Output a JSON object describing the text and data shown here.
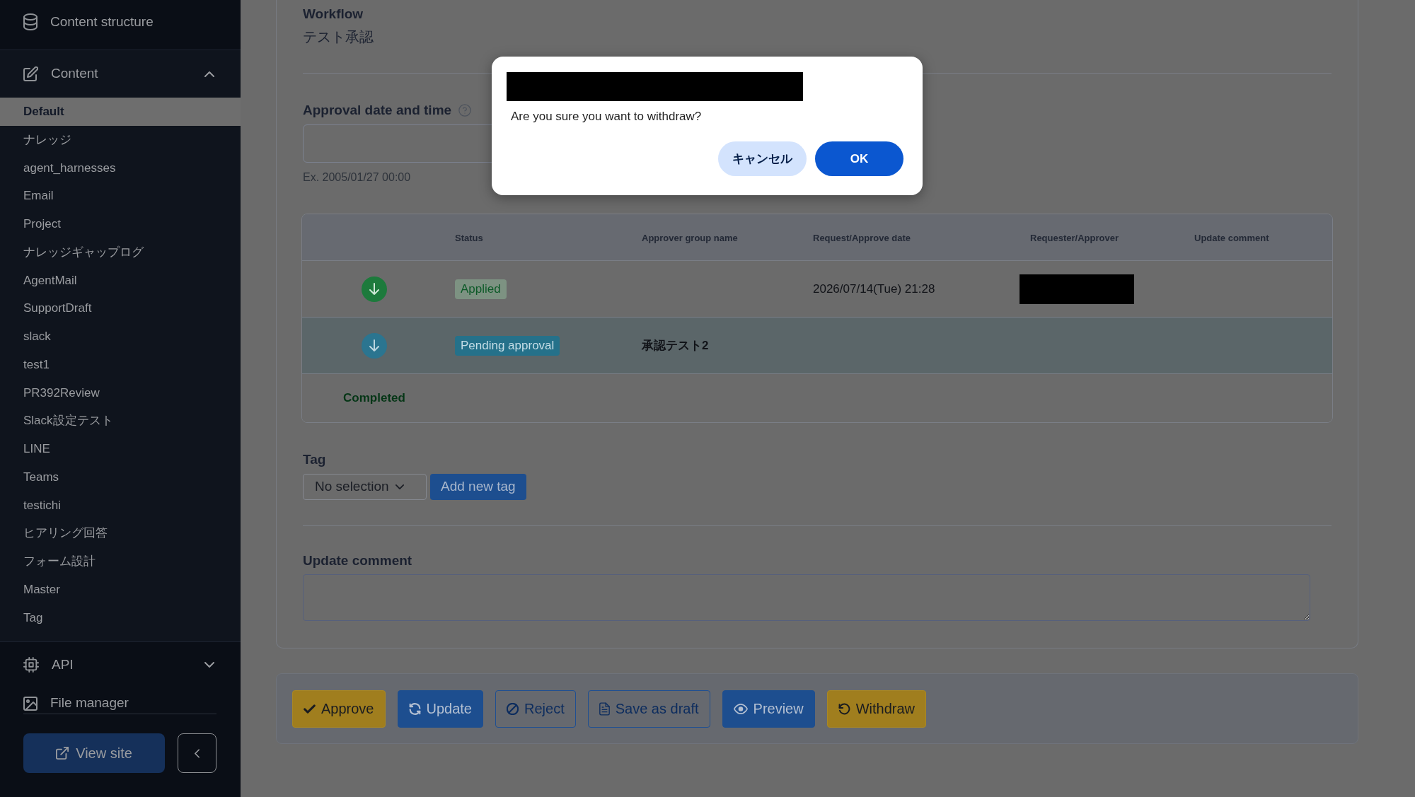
{
  "sidebar": {
    "structure_link": {
      "label": "Content structure"
    },
    "content_menu": {
      "label": "Content",
      "expanded": true,
      "items": [
        {
          "label": "Default",
          "selected": true
        },
        {
          "label": "ナレッジ",
          "selected": false
        },
        {
          "label": "agent_harnesses",
          "selected": false
        },
        {
          "label": "Email",
          "selected": false
        },
        {
          "label": "Project",
          "selected": false
        },
        {
          "label": "ナレッジギャップログ",
          "selected": false
        },
        {
          "label": "AgentMail",
          "selected": false
        },
        {
          "label": "SupportDraft",
          "selected": false
        },
        {
          "label": "slack",
          "selected": false
        },
        {
          "label": "test1",
          "selected": false
        },
        {
          "label": "PR392Review",
          "selected": false
        },
        {
          "label": "Slack設定テスト",
          "selected": false
        },
        {
          "label": "LINE",
          "selected": false
        },
        {
          "label": "Teams",
          "selected": false
        },
        {
          "label": "testichi",
          "selected": false
        },
        {
          "label": "ヒアリング回答",
          "selected": false
        },
        {
          "label": "フォーム設計",
          "selected": false
        },
        {
          "label": "Master",
          "selected": false
        },
        {
          "label": "Tag",
          "selected": false
        }
      ]
    },
    "api_menu": {
      "label": "API",
      "expanded": false
    },
    "file_manager_link": {
      "label": "File manager"
    },
    "view_site_button": {
      "label": "View site"
    }
  },
  "form": {
    "workflow": {
      "label": "Workflow",
      "value": "テスト承認"
    },
    "approval_datetime": {
      "label": "Approval date and time",
      "example": "Ex. 2005/01/27 00:00"
    },
    "approval_table": {
      "columns": [
        "Status",
        "Approver group name",
        "Request/Approve date",
        "Requester/Approver",
        "Update comment"
      ],
      "rows": [
        {
          "kind": "applied",
          "status": "Applied",
          "request_date": "2026/07/14(Tue) 21:28",
          "requester_redacted": true,
          "current": false
        },
        {
          "kind": "pending",
          "status": "Pending approval",
          "approver_group": "承認テスト2",
          "requester_redacted": false,
          "current": true
        }
      ],
      "footer": "Completed"
    },
    "tag": {
      "label": "Tag",
      "selection": "No selection",
      "add_button": "Add new tag"
    },
    "update_comment": {
      "label": "Update comment"
    }
  },
  "actions": [
    {
      "label": "Approve",
      "kind": "approve"
    },
    {
      "label": "Update",
      "kind": "update"
    },
    {
      "label": "Reject",
      "kind": "reject"
    },
    {
      "label": "Save as draft",
      "kind": "draft"
    },
    {
      "label": "Preview",
      "kind": "preview"
    },
    {
      "label": "Withdraw",
      "kind": "withdraw"
    }
  ],
  "confirm_dialog": {
    "title_redacted": true,
    "message": "Are you sure you want to withdraw?",
    "buttons": [
      {
        "label": "キャンセル",
        "kind": "secondary"
      },
      {
        "label": "OK",
        "kind": "primary"
      }
    ]
  }
}
